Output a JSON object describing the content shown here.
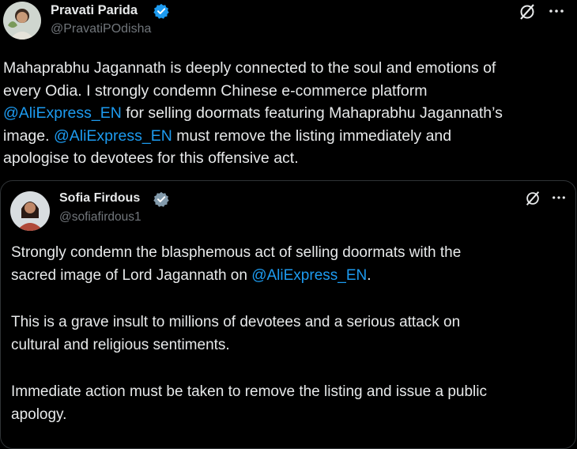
{
  "main_tweet": {
    "author_name": "Pravati Parida",
    "handle": "@PravatiPOdisha",
    "text_lines": [
      [
        "Mahaprabhu Jagannath is deeply connected to the soul and emotions of"
      ],
      [
        "every Odia. I strongly condemn Chinese e-commerce platform"
      ],
      [
        "@AliExpress_EN",
        " for selling doormats featuring Mahaprabhu Jagannath’s"
      ],
      [
        "image. ",
        "@AliExpress_EN",
        " must remove the listing immediately and"
      ],
      [
        "apologise to devotees for this offensive act."
      ]
    ]
  },
  "quoted_tweet": {
    "author_name": "Sofia Firdous",
    "handle": "@sofiafirdous1",
    "paragraphs": [
      [
        "Strongly condemn the blasphemous act of selling doormats with the",
        "sacred image of Lord Jagannath on "
      ],
      [
        "This is a grave insult to millions of devotees and a serious attack on",
        "cultural and religious sentiments."
      ],
      [
        "Immediate action must be taken to remove the listing and issue a public",
        "apology."
      ]
    ],
    "mention": "@AliExpress_EN",
    "mention_suffix": "."
  },
  "colors": {
    "link": "#1d9bf0",
    "verified_badge_main": "#1d9bf0",
    "verified_badge_quote": "#829aab",
    "muted": "#71767b"
  },
  "icons": [
    "verified-badge-icon",
    "grok-icon",
    "more-icon"
  ]
}
